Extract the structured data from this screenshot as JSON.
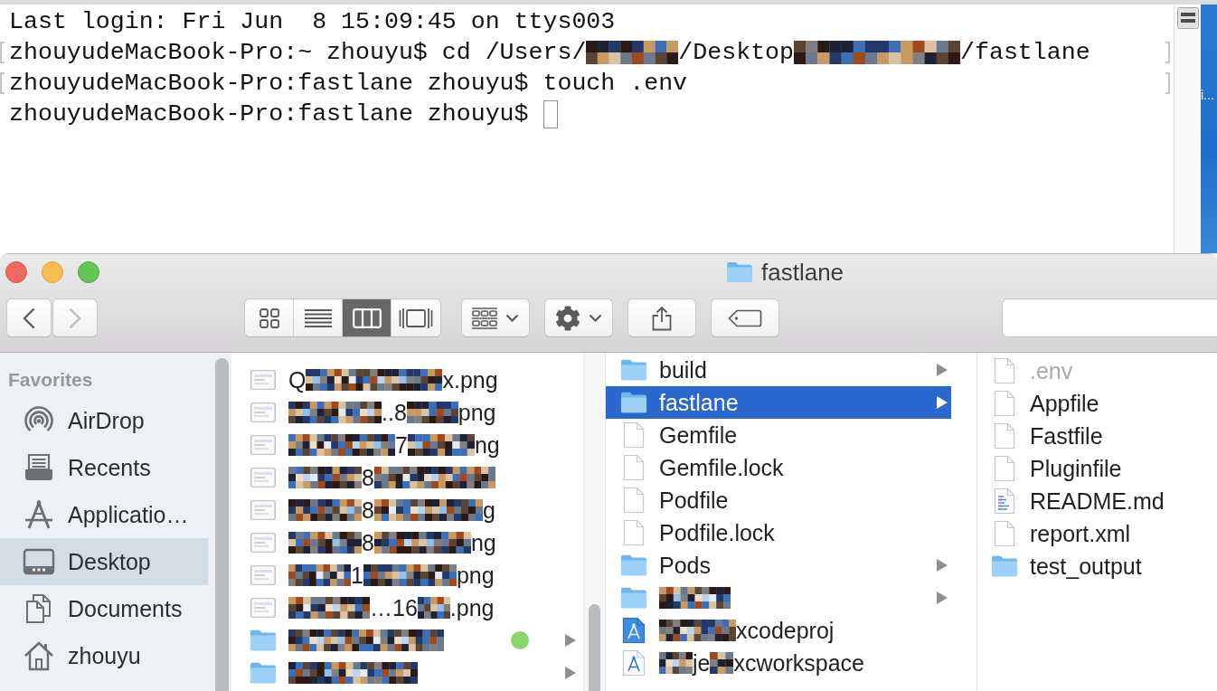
{
  "terminal": {
    "lines": [
      {
        "marked": false,
        "cursor": false,
        "segments": [
          {
            "kind": "text",
            "text": "Last login: Fri Jun  8 15:09:45 on ttys003"
          }
        ]
      },
      {
        "marked": true,
        "cursor": false,
        "segments": [
          {
            "kind": "text",
            "text": "zhouyudeMacBook-Pro:~ zhouyu$ cd /Users/"
          },
          {
            "kind": "redacted"
          },
          {
            "kind": "text",
            "text": "/Desktop"
          },
          {
            "kind": "redacted"
          },
          {
            "kind": "text",
            "text": "/fastlane"
          }
        ]
      },
      {
        "marked": true,
        "cursor": false,
        "segments": [
          {
            "kind": "text",
            "text": "zhouyudeMacBook-Pro:fastlane zhouyu$ touch .env"
          }
        ]
      },
      {
        "marked": false,
        "cursor": true,
        "segments": [
          {
            "kind": "text",
            "text": "zhouyudeMacBook-Pro:fastlane zhouyu$"
          }
        ]
      }
    ]
  },
  "desktop": {
    "label": "i..."
  },
  "finder": {
    "title": "fastlane",
    "toolbar": {
      "back": {
        "disabled": false
      },
      "forward": {
        "disabled": true
      },
      "view_modes": [
        {
          "kind": "icons",
          "selected": false
        },
        {
          "kind": "list",
          "selected": false
        },
        {
          "kind": "columns",
          "selected": true
        },
        {
          "kind": "gallery",
          "selected": false
        }
      ],
      "buttons": [
        {
          "kind": "arrange"
        },
        {
          "kind": "action"
        },
        {
          "kind": "share"
        },
        {
          "kind": "tags"
        }
      ]
    },
    "sidebar": {
      "heading": "Favorites",
      "items": [
        {
          "kind": "airdrop",
          "label": "AirDrop",
          "selected": false
        },
        {
          "kind": "recents",
          "label": "Recents",
          "selected": false
        },
        {
          "kind": "applications",
          "label": "Applicatio…",
          "selected": false
        },
        {
          "kind": "desktop",
          "label": "Desktop",
          "selected": true
        },
        {
          "kind": "documents",
          "label": "Documents",
          "selected": false
        },
        {
          "kind": "home",
          "label": "zhouyu",
          "selected": false
        }
      ]
    },
    "columns": [
      {
        "items": [
          {
            "kind": "image",
            "selected": false,
            "expandable": false,
            "parts": [
              {
                "kind": "text",
                "text": "Q"
              },
              {
                "kind": "redacted"
              },
              {
                "kind": "text",
                "text": "x.png"
              }
            ]
          },
          {
            "kind": "image",
            "selected": false,
            "expandable": false,
            "parts": [
              {
                "kind": "redacted"
              },
              {
                "kind": "text",
                "text": "..8"
              },
              {
                "kind": "redacted"
              },
              {
                "kind": "text",
                "text": "png"
              }
            ]
          },
          {
            "kind": "image",
            "selected": false,
            "expandable": false,
            "parts": [
              {
                "kind": "redacted"
              },
              {
                "kind": "text",
                "text": "7"
              },
              {
                "kind": "redacted"
              },
              {
                "kind": "text",
                "text": "ng"
              }
            ]
          },
          {
            "kind": "image",
            "selected": false,
            "expandable": false,
            "parts": [
              {
                "kind": "redacted"
              },
              {
                "kind": "text",
                "text": "8"
              },
              {
                "kind": "redacted"
              }
            ]
          },
          {
            "kind": "image",
            "selected": false,
            "expandable": false,
            "parts": [
              {
                "kind": "redacted"
              },
              {
                "kind": "text",
                "text": "8"
              },
              {
                "kind": "redacted"
              },
              {
                "kind": "text",
                "text": "g"
              }
            ]
          },
          {
            "kind": "image",
            "selected": false,
            "expandable": false,
            "parts": [
              {
                "kind": "redacted"
              },
              {
                "kind": "text",
                "text": "8"
              },
              {
                "kind": "redacted"
              },
              {
                "kind": "text",
                "text": "ng"
              }
            ]
          },
          {
            "kind": "image",
            "selected": false,
            "expandable": false,
            "parts": [
              {
                "kind": "redacted"
              },
              {
                "kind": "text",
                "text": "1"
              },
              {
                "kind": "redacted"
              },
              {
                "kind": "text",
                "text": "png"
              }
            ]
          },
          {
            "kind": "image",
            "selected": false,
            "expandable": false,
            "parts": [
              {
                "kind": "redacted"
              },
              {
                "kind": "text",
                "text": "…16"
              },
              {
                "kind": "redacted"
              },
              {
                "kind": "text",
                "text": ".png"
              }
            ]
          },
          {
            "kind": "folder",
            "selected": false,
            "expandable": true,
            "color": "#8bd46a",
            "parts": [
              {
                "kind": "redacted"
              }
            ]
          },
          {
            "kind": "folder",
            "selected": false,
            "expandable": true,
            "parts": [
              {
                "kind": "redacted"
              }
            ]
          }
        ]
      },
      {
        "items": [
          {
            "kind": "folder",
            "name": "build",
            "selected": false,
            "expandable": true
          },
          {
            "kind": "folder",
            "name": "fastlane",
            "selected": true,
            "expandable": true
          },
          {
            "kind": "file",
            "name": "Gemfile",
            "selected": false,
            "expandable": false
          },
          {
            "kind": "file",
            "name": "Gemfile.lock",
            "selected": false,
            "expandable": false
          },
          {
            "kind": "file",
            "name": "Podfile",
            "selected": false,
            "expandable": false
          },
          {
            "kind": "file",
            "name": "Podfile.lock",
            "selected": false,
            "expandable": false
          },
          {
            "kind": "folder",
            "name": "Pods",
            "selected": false,
            "expandable": true
          },
          {
            "kind": "folder",
            "selected": false,
            "expandable": true,
            "parts": [
              {
                "kind": "redacted"
              }
            ]
          },
          {
            "kind": "xcodeproj",
            "selected": false,
            "expandable": false,
            "parts": [
              {
                "kind": "redacted"
              },
              {
                "kind": "text",
                "text": "xcodeproj"
              }
            ]
          },
          {
            "kind": "xcworkspace",
            "selected": false,
            "expandable": false,
            "parts": [
              {
                "kind": "redacted"
              },
              {
                "kind": "text",
                "text": "je"
              },
              {
                "kind": "redacted"
              },
              {
                "kind": "text",
                "text": "xcworkspace"
              }
            ]
          }
        ]
      },
      {
        "items": [
          {
            "kind": "file",
            "name": ".env",
            "hidden": true,
            "selected": false,
            "expandable": false
          },
          {
            "kind": "file",
            "name": "Appfile",
            "hidden": false,
            "selected": false,
            "expandable": false
          },
          {
            "kind": "file",
            "name": "Fastfile",
            "hidden": false,
            "selected": false,
            "expandable": false
          },
          {
            "kind": "file",
            "name": "Pluginfile",
            "hidden": false,
            "selected": false,
            "expandable": false
          },
          {
            "kind": "markdown",
            "name": "README.md",
            "hidden": false,
            "selected": false,
            "expandable": false
          },
          {
            "kind": "file",
            "name": "report.xml",
            "hidden": false,
            "selected": false,
            "expandable": false
          },
          {
            "kind": "folder",
            "name": "test_output",
            "hidden": false,
            "selected": false,
            "expandable": false
          }
        ]
      }
    ]
  }
}
